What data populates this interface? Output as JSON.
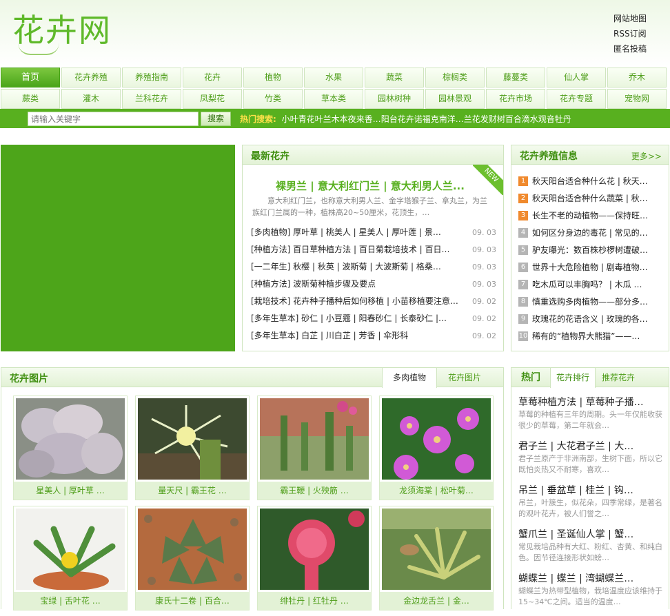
{
  "header": {
    "logo_text": "花卉网",
    "links": [
      "网站地图",
      "RSS订阅",
      "匿名投稿"
    ]
  },
  "nav": {
    "row1": [
      "首页",
      "花卉养殖",
      "养殖指南",
      "花卉",
      "植物",
      "水果",
      "蔬菜",
      "棕榈类",
      "藤蔓类",
      "仙人掌",
      "乔木"
    ],
    "row2": [
      "蕨类",
      "灌木",
      "兰科花卉",
      "凤梨花",
      "竹类",
      "草本类",
      "园林树种",
      "园林景观",
      "花卉市场",
      "花卉专题",
      "宠物网"
    ],
    "active": "首页"
  },
  "search": {
    "placeholder": "请输入关键字",
    "button": "搜索",
    "hot_label": "热门搜索:",
    "keywords": [
      "小叶青",
      "花叶兰",
      "木本夜来香…",
      "阳台花卉",
      "诺福克南洋…",
      "兰花",
      "发财树",
      "百合",
      "滴水观音",
      "牡丹"
    ]
  },
  "newest": {
    "title": "最新花卉",
    "badge": "NEW",
    "headline": "裸男兰 | 意大利红门兰 | 意大利男人兰...",
    "summary": "意大利红门兰，也称意大利男人兰、金字塔猴子兰、拿丸兰，为兰族红门兰属的一种，植株高20~50厘米，花顶生，…",
    "items": [
      {
        "text": "[多肉植物] 厚叶草 | 桃美人 | 星美人 | 厚叶莲 | 景…",
        "date": "09. 03"
      },
      {
        "text": "[种植方法] 百日草种植方法 | 百日菊栽培技术 | 百日…",
        "date": "09. 03"
      },
      {
        "text": "[一二年生] 秋樱 | 秋英 | 波斯菊 | 大波斯菊 | 格桑…",
        "date": "09. 03"
      },
      {
        "text": "[种植方法] 波斯菊种植步骤及要点",
        "date": "09. 03"
      },
      {
        "text": "[栽培技术] 花卉种子播种后如何移植 | 小苗移植要注意…",
        "date": "09. 02"
      },
      {
        "text": "[多年生草本] 砂仁 | 小豆蔻 | 阳春砂仁 | 长泰砂仁 |…",
        "date": "09. 02"
      },
      {
        "text": "[多年生草本] 白芷 | 川白芷 | 芳香 | 伞形科",
        "date": "09. 02"
      }
    ]
  },
  "info": {
    "title": "花卉养殖信息",
    "more": "更多>>",
    "items": [
      "秋天阳台适合种什么花 | 秋天…",
      "秋天阳台适合种什么蔬菜 | 秋…",
      "长生不老的动植物——保持旺…",
      "如何区分身边的毒花 | 常见的…",
      "驴友曝光：数百株杪椤树遭破…",
      "世界十大危险植物 | 剧毒植物…",
      "吃木瓜可以丰胸吗？ | 木瓜 …",
      "慎重选购多肉植物——部分多…",
      "玫瑰花的花语含义 | 玫瑰的各…",
      "稀有的“植物界大熊猫”——…"
    ]
  },
  "pictures": {
    "title": "花卉图片",
    "tabs": [
      "多肉植物",
      "花卉图片"
    ],
    "items": [
      {
        "caption": "星美人 | 厚叶草 …",
        "icon": "succulent-photo"
      },
      {
        "caption": "量天尺 | 霸王花 …",
        "icon": "cactus-flower-photo"
      },
      {
        "caption": "霸王鞭 | 火殃筋 …",
        "icon": "cactus-garden-photo"
      },
      {
        "caption": "龙须海棠 | 松叶菊…",
        "icon": "pink-flower-photo"
      },
      {
        "caption": "宝绿 | 舌叶花 …",
        "icon": "yellow-flower-photo"
      },
      {
        "caption": "康氏十二卷 | 百合…",
        "icon": "haworthia-photo"
      },
      {
        "caption": "绯牡丹 | 红牡丹 …",
        "icon": "red-cactus-photo"
      },
      {
        "caption": "金边龙舌兰 | 金…",
        "icon": "agave-photo"
      }
    ]
  },
  "hot": {
    "tabs": [
      "热门",
      "花卉排行",
      "推荐花卉"
    ],
    "items": [
      {
        "title": "草莓种植方法 | 草莓种子播…",
        "desc": "草莓的种植有三年的周期。头一年仅能收获很少的草莓，第二年就会…"
      },
      {
        "title": "君子兰 | 大花君子兰 | 大…",
        "desc": "君子兰原产于非洲南部，生树下面，所以它既怕炎热又不耐寒，喜欢…"
      },
      {
        "title": "吊兰 | 垂盆草 | 桂兰 | 钩…",
        "desc": "吊兰，叶簇生，似花朵，四季常绿，是著名的观叶花卉，被人们誉之…"
      },
      {
        "title": "蟹爪兰 | 圣诞仙人掌 | 蟹…",
        "desc": "常见栽培品种有大红、粉红、杏黄、和纯白色。因节径连接形状如螃…"
      },
      {
        "title": "蝴蝶兰 | 蝶兰 | 湾蝴蝶兰…",
        "desc": "蝴蝶兰为热带型植物，栽培温度应该维持于15~34℃之间。适当的温度…"
      }
    ]
  },
  "colors": {
    "brand": "#58b01f",
    "accent": "#4d9d18",
    "rank_hot": "#f08a2e"
  }
}
